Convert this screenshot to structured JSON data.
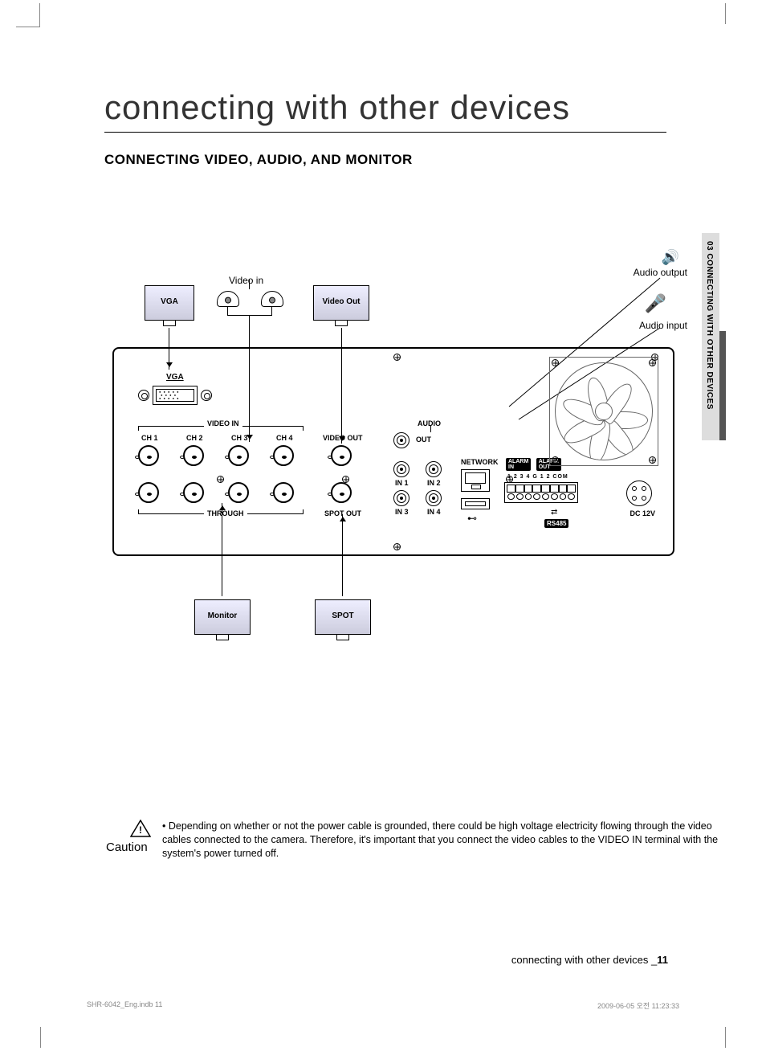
{
  "title": "connecting with other devices",
  "subtitle": "CONNECTING VIDEO, AUDIO, AND MONITOR",
  "side_tab": "03 CONNECTING WITH OTHER DEVICES",
  "diagram": {
    "audio_output": "Audio output",
    "audio_input": "Audio input",
    "video_in": "Video in",
    "vga_monitor": "VGA",
    "videoout_monitor": "Video Out",
    "monitor_label": "Monitor",
    "spot_label": "SPOT",
    "panel": {
      "vga": "VGA",
      "video_in": "VIDEO IN",
      "ch1": "CH 1",
      "ch2": "CH 2",
      "ch3": "CH 3",
      "ch4": "CH 4",
      "video_out": "VIDEO OUT",
      "through": "THROUGH",
      "spot_out": "SPOT OUT",
      "audio": "AUDIO",
      "out": "OUT",
      "in1": "IN 1",
      "in2": "IN 2",
      "in3": "IN 3",
      "in4": "IN 4",
      "network": "NETWORK",
      "alarm_in": "ALARM IN",
      "alarm_out": "ALARM OUT",
      "alarm_pins": "1 2 3 4 G 1 2 COM",
      "rs485": "RS485",
      "dc12v": "DC 12V"
    }
  },
  "caution": {
    "label": "Caution",
    "bullet": "•",
    "text": "Depending on whether or not the power cable is grounded, there could be high voltage electricity flowing through the video cables connected to the camera. Therefore, it's important that you connect the video cables to the VIDEO IN terminal with the system's power turned off."
  },
  "footer": {
    "section": "connecting with other devices _",
    "page": "11"
  },
  "print": {
    "left": "SHR-6042_Eng.indb   11",
    "right": "2009-06-05   오전 11:23:33"
  }
}
